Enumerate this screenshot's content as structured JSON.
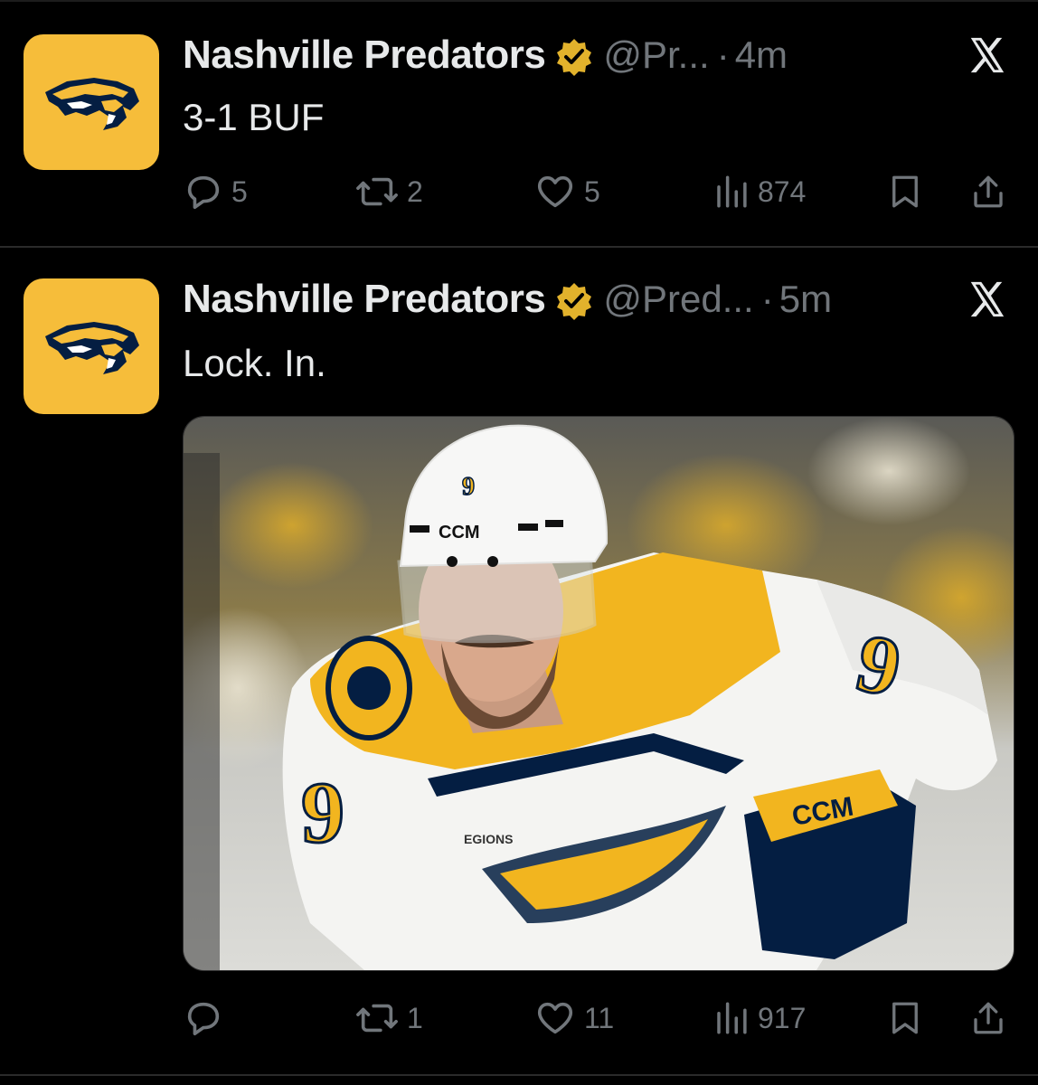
{
  "colors": {
    "background": "#000000",
    "text": "#e7e9ea",
    "muted": "#71767b",
    "brand_gold": "#f6bd3a",
    "brand_navy": "#041e42",
    "verified": "#e2b22c"
  },
  "tweets": [
    {
      "author_name": "Nashville Predators",
      "handle": "@Pr...",
      "separator": "·",
      "time": "4m",
      "text": "3-1 BUF",
      "has_media": false,
      "replies": "5",
      "reposts": "2",
      "likes": "5",
      "views": "874",
      "avatar_icon": "predators-logo-icon",
      "verified_icon": "verified-badge-icon",
      "platform_icon": "x-logo-icon"
    },
    {
      "author_name": "Nashville Predators",
      "handle": "@Pred...",
      "separator": "·",
      "time": "5m",
      "text": "Lock. In.",
      "has_media": true,
      "media_description_icon": "hockey-player-photo",
      "replies": "",
      "reposts": "1",
      "likes": "11",
      "views": "917",
      "avatar_icon": "predators-logo-icon",
      "verified_icon": "verified-badge-icon",
      "platform_icon": "x-logo-icon"
    }
  ],
  "photo": {
    "helmet_number": "9",
    "helmet_brand": "CCM",
    "jersey_number": "9",
    "sleeve_number": "9",
    "glove_brand": "CCM",
    "jersey_sponsor": "EGIONS"
  }
}
